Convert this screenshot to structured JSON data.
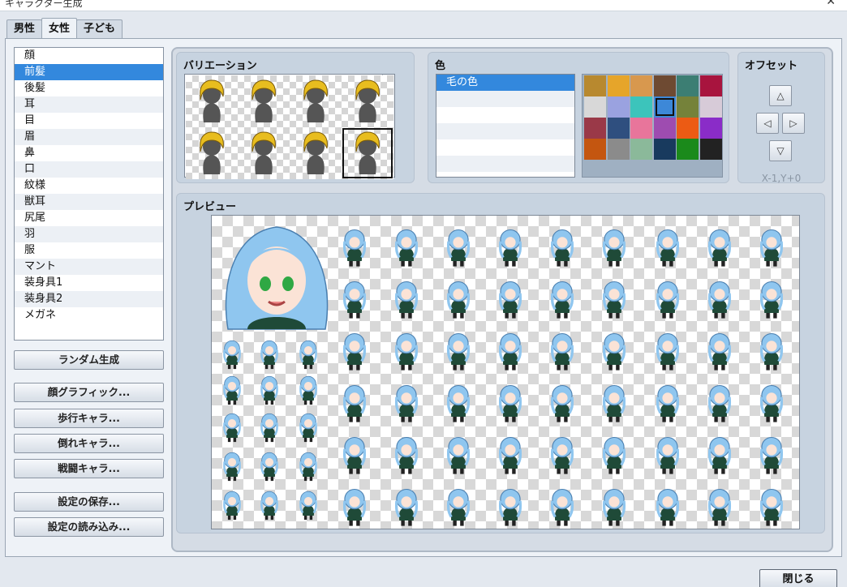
{
  "title": "キャラクター生成",
  "tabs": [
    "男性",
    "女性",
    "子ども"
  ],
  "active_tab": 1,
  "parts": [
    "顔",
    "前髪",
    "後髪",
    "耳",
    "目",
    "眉",
    "鼻",
    "口",
    "紋様",
    "獣耳",
    "尻尾",
    "羽",
    "服",
    "マント",
    "装身具1",
    "装身具2",
    "メガネ"
  ],
  "selected_part": 1,
  "buttons": {
    "random": "ランダム生成",
    "face": "顔グラフィック...",
    "walk": "歩行キャラ...",
    "damage": "倒れキャラ...",
    "battle": "戦闘キャラ...",
    "save": "設定の保存...",
    "load": "設定の読み込み...",
    "close": "閉じる"
  },
  "variation": {
    "title": "バリエーション",
    "count": 8,
    "selected": 7
  },
  "color": {
    "title": "色",
    "items": [
      "毛の色",
      "",
      "",
      "",
      "",
      ""
    ],
    "selected": 0,
    "palette": [
      "#b8892f",
      "#e6a52a",
      "#d8984e",
      "#6e4a32",
      "#3c7e73",
      "#a8143e",
      "#d8d8d8",
      "#9aa2e0",
      "#3cc4bb",
      "#3d88d8",
      "#75823a",
      "#d7cbd8",
      "#9a3948",
      "#2f4f7f",
      "#e8759b",
      "#9e4cb0",
      "#ec5b14",
      "#8a2cc8",
      "#c45610",
      "#8b8b8b",
      "#8bb99a",
      "#183a5e",
      "#1b8a1b",
      "#222222"
    ],
    "selected_swatch": 9
  },
  "offset": {
    "title": "オフセット",
    "value": "X-1,Y+0"
  },
  "preview": {
    "title": "プレビュー"
  },
  "colors": {
    "hair_selected": "#8fc6ef",
    "hair_variation": "#e8bd1f",
    "outfit": "#1f4a38"
  }
}
